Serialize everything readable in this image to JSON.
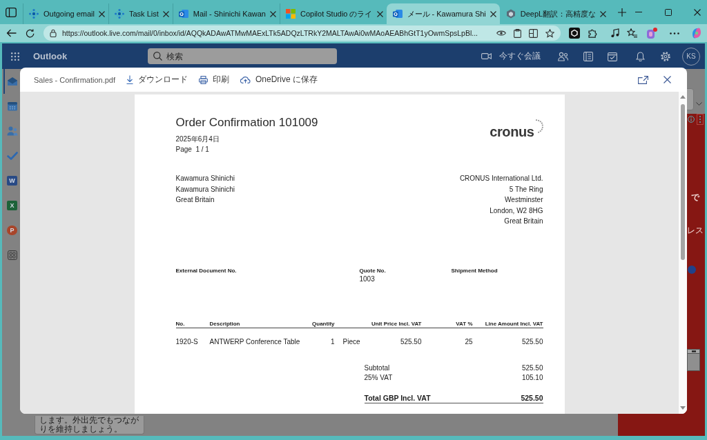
{
  "browser": {
    "tabs": [
      {
        "title": "Outgoing email",
        "kind": "dots",
        "selected": false
      },
      {
        "title": "Task List",
        "kind": "dots",
        "selected": false
      },
      {
        "title": "Mail - Shinichi Kawan",
        "kind": "mail",
        "selected": false
      },
      {
        "title": "Copilot Studio のライ",
        "kind": "squares",
        "selected": false
      },
      {
        "title": "メール - Kawamura Shi",
        "kind": "mail",
        "selected": true
      },
      {
        "title": "DeepL翻訳：高精度な",
        "kind": "hexagon",
        "selected": false
      }
    ],
    "url": "https://outlook.live.com/mail/0/inbox/id/AQQkADAwATMwMAExLTk5ADQzLTRkY2MALTAwAi0wMAoAEABhGtT1yOwmSpsLpBl..."
  },
  "outlook": {
    "app_name": "Outlook",
    "search": {
      "placeholder": "検索"
    },
    "meet_now": "今すぐ会議",
    "avatar": "KS",
    "rail": [
      {
        "kind": "mail",
        "selected": true
      },
      {
        "kind": "calendar",
        "selected": false
      },
      {
        "kind": "people",
        "selected": false
      },
      {
        "kind": "todo",
        "selected": false
      },
      {
        "kind": "word",
        "letter": "W",
        "selected": false
      },
      {
        "kind": "excel",
        "letter": "X",
        "selected": false
      },
      {
        "kind": "powerpoint",
        "letter": "P",
        "selected": false
      },
      {
        "kind": "apps",
        "selected": false
      }
    ],
    "promo_text": "します。外出先でもつながりを維持しましょう。",
    "side_panel": {
      "texts": [
        {
          "text": "で",
          "kind": "heading"
        },
        {
          "text": "レス",
          "kind": "body"
        }
      ]
    }
  },
  "viewer": {
    "file_name": "Sales - Confirmation.pdf",
    "actions": [
      {
        "kind": "download",
        "label": "ダウンロード"
      },
      {
        "kind": "print",
        "label": "印刷"
      },
      {
        "kind": "cloud",
        "label": "OneDrive に保存"
      }
    ]
  },
  "document": {
    "title": "Order Confirmation 101009",
    "date": "2025年6月4日",
    "page": "Page  1 / 1",
    "logo": "cronus",
    "customer": [
      "Kawamura Shinichi",
      "Kawamura Shinichi",
      "Great Britain"
    ],
    "company": [
      "CRONUS International Ltd.",
      "5 The Ring",
      "Westminster",
      "London, W2 8HG",
      "Great Britain"
    ],
    "fields": [
      {
        "label": "External Document No."
      },
      {
        "label": "Quote No.",
        "value": "1003"
      },
      {
        "label": "Shipment Method"
      }
    ],
    "table": {
      "columns": [
        "No.",
        "Description",
        "Quantity",
        "",
        "Unit Price Incl. VAT",
        "VAT %",
        "Line Amount Incl. VAT"
      ],
      "rows": [
        [
          "1920-S",
          "ANTWERP Conference Table",
          "1",
          "Piece",
          "525.50",
          "25",
          "525.50"
        ]
      ]
    },
    "totals": [
      {
        "label": "Subtotal",
        "value": "525.50",
        "kind": "line"
      },
      {
        "label": "25% VAT",
        "value": "105.10",
        "kind": "line"
      },
      {
        "label": "Total GBP Incl. VAT",
        "value": "525.50",
        "kind": "total"
      }
    ]
  }
}
